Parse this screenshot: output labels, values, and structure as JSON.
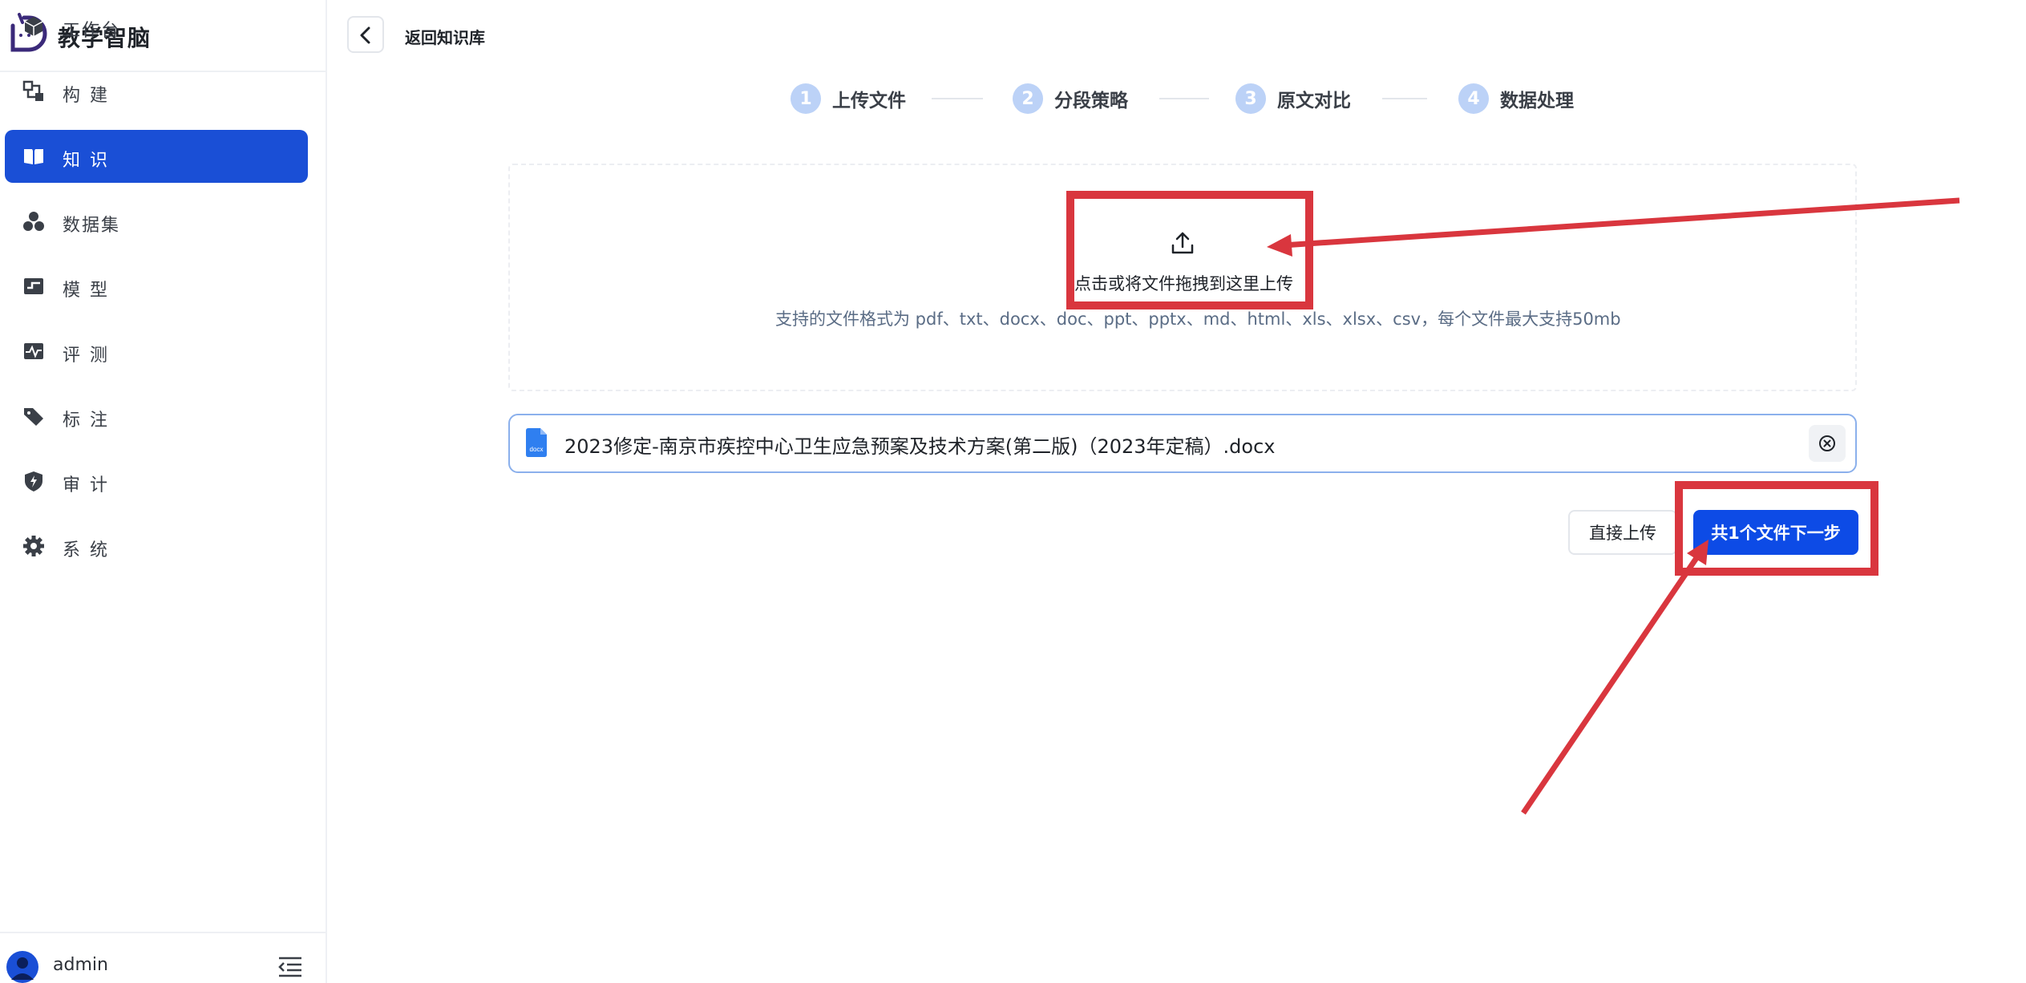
{
  "brand": {
    "title": "教学智脑"
  },
  "sidebar": {
    "items": [
      {
        "label": "工作台",
        "icon": "cube-icon",
        "active": false,
        "tight": true
      },
      {
        "label": "构建",
        "icon": "build-icon",
        "active": false,
        "tight": false
      },
      {
        "label": "知识",
        "icon": "book-icon",
        "active": true,
        "tight": false
      },
      {
        "label": "数据集",
        "icon": "dataset-icon",
        "active": false,
        "tight": true
      },
      {
        "label": "模型",
        "icon": "model-icon",
        "active": false,
        "tight": false
      },
      {
        "label": "评测",
        "icon": "pulse-icon",
        "active": false,
        "tight": false
      },
      {
        "label": "标注",
        "icon": "tag-icon",
        "active": false,
        "tight": false
      },
      {
        "label": "审计",
        "icon": "shield-bolt-icon",
        "active": false,
        "tight": false
      },
      {
        "label": "系统",
        "icon": "gear-icon",
        "active": false,
        "tight": false
      }
    ],
    "user": "admin"
  },
  "header": {
    "back_label": "返回知识库"
  },
  "steps": [
    {
      "num": "1",
      "label": "上传文件",
      "active": true
    },
    {
      "num": "2",
      "label": "分段策略",
      "active": false
    },
    {
      "num": "3",
      "label": "原文对比",
      "active": false
    },
    {
      "num": "4",
      "label": "数据处理",
      "active": false
    }
  ],
  "upload": {
    "prompt": "点击或将文件拖拽到这里上传",
    "formats": "支持的文件格式为 pdf、txt、docx、doc、ppt、pptx、md、html、xls、xlsx、csv，每个文件最大支持50mb"
  },
  "file": {
    "name": "2023修定-南京市疾控中心卫生应急预案及技术方案(第二版)（2023年定稿）.docx",
    "badge": "docx"
  },
  "actions": {
    "direct_upload": "直接上传",
    "next": "共1个文件下一步"
  },
  "colors": {
    "primary": "#1a4fd6",
    "annotation": "#d9363e"
  }
}
